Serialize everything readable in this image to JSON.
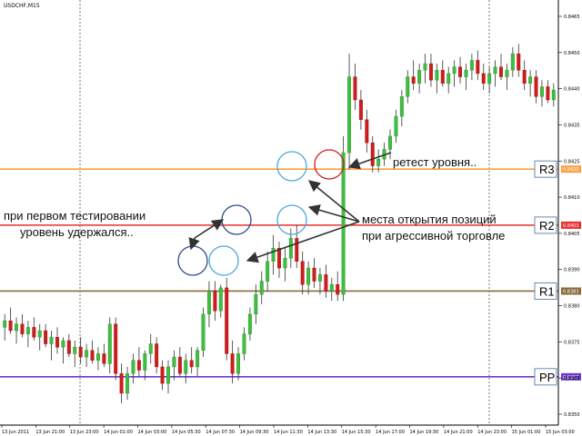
{
  "chart_data": {
    "type": "candlestick",
    "title": "USDCHF,M15",
    "ylim": [
      0.8344,
      0.8468
    ],
    "y_ticks": [
      "0.8465",
      "0.8450",
      "0.8440",
      "0.8435",
      "0.8425",
      "0.8410",
      "0.8405",
      "0.8390",
      "0.8380",
      "0.8375",
      "0.8365",
      "0.8350"
    ],
    "x_ticks": [
      "13 Jun 2011",
      "13 Jun 21:00",
      "13 Jun 23:00",
      "14 Jun 01:00",
      "14 Jun 03:00",
      "14 Jun 05:30",
      "14 Jun 07:30",
      "14 Jun 09:30",
      "14 Jun 11:30",
      "14 Jun 13:30",
      "14 Jun 15:30",
      "14 Jun 17:00",
      "14 Jun 19:30",
      "14 Jun 21:00",
      "14 Jun 23:00",
      "15 Jun 01:00",
      "15 Jun 03:00"
    ],
    "grid": "vertical dotted separators",
    "levels": [
      {
        "name": "R3",
        "price": 0.842,
        "tag": "0.8420",
        "color": "#ffa040"
      },
      {
        "name": "R2",
        "price": 0.8403,
        "tag": "0.8403",
        "color": "#e83030"
      },
      {
        "name": "R1",
        "price": 0.8383,
        "tag": "0.8383",
        "color": "#8a6a3a"
      },
      {
        "name": "PP",
        "price": 0.8357,
        "tag": "0.8357",
        "color": "#6a3ad0"
      }
    ],
    "annotations": {
      "retest": "ретест уровня..",
      "first_test_line1": "при первом тестировании",
      "first_test_line2": "уровень удержался..",
      "entry_line1": "места открытия позиций",
      "entry_line2": "при агрессивной торговле"
    },
    "candles": [
      [
        0.8372,
        0.8376,
        0.8368,
        0.8374
      ],
      [
        0.8374,
        0.8378,
        0.837,
        0.8371
      ],
      [
        0.8371,
        0.8375,
        0.8367,
        0.8373
      ],
      [
        0.8373,
        0.8376,
        0.8369,
        0.837
      ],
      [
        0.837,
        0.8374,
        0.8366,
        0.8372
      ],
      [
        0.8372,
        0.8375,
        0.8368,
        0.8369
      ],
      [
        0.8369,
        0.8373,
        0.8365,
        0.8371
      ],
      [
        0.8371,
        0.8373,
        0.8366,
        0.8367
      ],
      [
        0.8367,
        0.8371,
        0.8362,
        0.8369
      ],
      [
        0.8369,
        0.8372,
        0.8364,
        0.8366
      ],
      [
        0.8366,
        0.8369,
        0.8361,
        0.8368
      ],
      [
        0.8368,
        0.837,
        0.8363,
        0.8364
      ],
      [
        0.8364,
        0.8368,
        0.836,
        0.8366
      ],
      [
        0.8366,
        0.8369,
        0.8361,
        0.8363
      ],
      [
        0.8363,
        0.8367,
        0.836,
        0.8365
      ],
      [
        0.8365,
        0.8368,
        0.8361,
        0.8362
      ],
      [
        0.8362,
        0.8366,
        0.8359,
        0.8364
      ],
      [
        0.8364,
        0.8367,
        0.836,
        0.8361
      ],
      [
        0.8361,
        0.8375,
        0.8358,
        0.8373
      ],
      [
        0.8373,
        0.8375,
        0.8356,
        0.8358
      ],
      [
        0.8358,
        0.8361,
        0.8349,
        0.8352
      ],
      [
        0.8352,
        0.836,
        0.835,
        0.8358
      ],
      [
        0.8358,
        0.8364,
        0.8355,
        0.8362
      ],
      [
        0.8362,
        0.8366,
        0.8357,
        0.8359
      ],
      [
        0.8359,
        0.8365,
        0.8356,
        0.8364
      ],
      [
        0.8364,
        0.837,
        0.8361,
        0.8367
      ],
      [
        0.8367,
        0.8369,
        0.8358,
        0.836
      ],
      [
        0.836,
        0.8362,
        0.8353,
        0.8355
      ],
      [
        0.8355,
        0.8362,
        0.8352,
        0.836
      ],
      [
        0.836,
        0.8365,
        0.8356,
        0.8363
      ],
      [
        0.8363,
        0.8366,
        0.8357,
        0.8358
      ],
      [
        0.8358,
        0.8364,
        0.8355,
        0.8362
      ],
      [
        0.8362,
        0.8366,
        0.8358,
        0.836
      ],
      [
        0.836,
        0.8366,
        0.8357,
        0.8365
      ],
      [
        0.8365,
        0.8378,
        0.8363,
        0.8376
      ],
      [
        0.8376,
        0.8386,
        0.8372,
        0.8383
      ],
      [
        0.8383,
        0.8386,
        0.8374,
        0.8377
      ],
      [
        0.8377,
        0.8385,
        0.8375,
        0.8384
      ],
      [
        0.8384,
        0.8387,
        0.8362,
        0.8364
      ],
      [
        0.8364,
        0.8368,
        0.8355,
        0.8358
      ],
      [
        0.8358,
        0.8366,
        0.8356,
        0.8364
      ],
      [
        0.8364,
        0.8372,
        0.8362,
        0.837
      ],
      [
        0.837,
        0.8378,
        0.8368,
        0.8376
      ],
      [
        0.8376,
        0.8385,
        0.8373,
        0.8382
      ],
      [
        0.8382,
        0.8389,
        0.8379,
        0.8386
      ],
      [
        0.8386,
        0.8395,
        0.8383,
        0.8392
      ],
      [
        0.8392,
        0.84,
        0.8388,
        0.8396
      ],
      [
        0.8396,
        0.8398,
        0.8387,
        0.839
      ],
      [
        0.839,
        0.8396,
        0.8386,
        0.8393
      ],
      [
        0.8393,
        0.8402,
        0.839,
        0.8399
      ],
      [
        0.8399,
        0.8403,
        0.839,
        0.8392
      ],
      [
        0.8392,
        0.8395,
        0.8382,
        0.8385
      ],
      [
        0.8385,
        0.8392,
        0.8382,
        0.839
      ],
      [
        0.839,
        0.8393,
        0.8384,
        0.8386
      ],
      [
        0.8386,
        0.839,
        0.8382,
        0.8388
      ],
      [
        0.8388,
        0.8391,
        0.8381,
        0.8383
      ],
      [
        0.8383,
        0.8387,
        0.838,
        0.8385
      ],
      [
        0.8385,
        0.8389,
        0.838,
        0.8382
      ],
      [
        0.8382,
        0.843,
        0.838,
        0.8425
      ],
      [
        0.8425,
        0.8455,
        0.842,
        0.8448
      ],
      [
        0.8448,
        0.8452,
        0.8438,
        0.8441
      ],
      [
        0.8441,
        0.8444,
        0.8432,
        0.8435
      ],
      [
        0.8435,
        0.8438,
        0.8425,
        0.8428
      ],
      [
        0.8428,
        0.843,
        0.8419,
        0.8421
      ],
      [
        0.8421,
        0.8426,
        0.8419,
        0.8423
      ],
      [
        0.8423,
        0.8428,
        0.8421,
        0.8426
      ],
      [
        0.8426,
        0.8432,
        0.8423,
        0.843
      ],
      [
        0.843,
        0.8438,
        0.8428,
        0.8436
      ],
      [
        0.8436,
        0.8444,
        0.8433,
        0.8442
      ],
      [
        0.8442,
        0.845,
        0.844,
        0.8448
      ],
      [
        0.8448,
        0.8453,
        0.8444,
        0.8446
      ],
      [
        0.8446,
        0.8452,
        0.8443,
        0.845
      ],
      [
        0.845,
        0.8455,
        0.8446,
        0.8452
      ],
      [
        0.8452,
        0.8455,
        0.8445,
        0.8447
      ],
      [
        0.8447,
        0.8452,
        0.8443,
        0.845
      ],
      [
        0.845,
        0.8453,
        0.8445,
        0.8446
      ],
      [
        0.8446,
        0.8451,
        0.8443,
        0.8449
      ],
      [
        0.8449,
        0.8453,
        0.8445,
        0.8451
      ],
      [
        0.8451,
        0.8454,
        0.8446,
        0.8448
      ],
      [
        0.8448,
        0.8452,
        0.8444,
        0.845
      ],
      [
        0.845,
        0.8455,
        0.8447,
        0.8453
      ],
      [
        0.8453,
        0.8456,
        0.8447,
        0.8449
      ],
      [
        0.8449,
        0.8452,
        0.8444,
        0.8446
      ],
      [
        0.8446,
        0.8451,
        0.8443,
        0.8449
      ],
      [
        0.8449,
        0.8453,
        0.8445,
        0.8451
      ],
      [
        0.8451,
        0.8455,
        0.8447,
        0.8448
      ],
      [
        0.8448,
        0.8452,
        0.8444,
        0.845
      ],
      [
        0.845,
        0.8457,
        0.8448,
        0.8455
      ],
      [
        0.8455,
        0.8458,
        0.8448,
        0.845
      ],
      [
        0.845,
        0.8453,
        0.8444,
        0.8446
      ],
      [
        0.8446,
        0.845,
        0.8442,
        0.8448
      ],
      [
        0.8448,
        0.845,
        0.844,
        0.8442
      ],
      [
        0.8442,
        0.8447,
        0.8439,
        0.8445
      ],
      [
        0.8445,
        0.8447,
        0.844,
        0.8441
      ],
      [
        0.8441,
        0.8446,
        0.8439,
        0.8444
      ]
    ]
  }
}
